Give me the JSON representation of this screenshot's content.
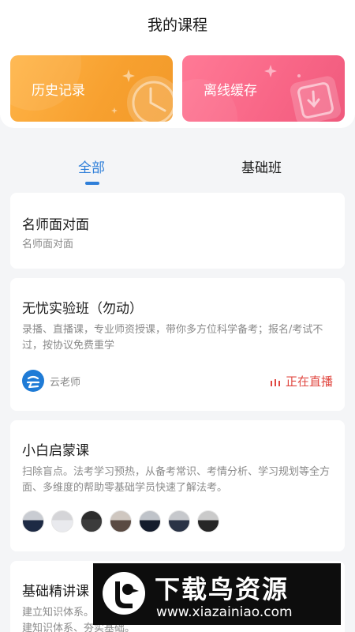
{
  "header": {
    "title": "我的课程"
  },
  "quick_actions": {
    "history": {
      "label": "历史记录",
      "color": "#f7a02f",
      "icon": "clock-icon"
    },
    "offline": {
      "label": "离线缓存",
      "color": "#f86586",
      "icon": "download-icon"
    }
  },
  "tabs": [
    {
      "label": "全部",
      "active": true
    },
    {
      "label": "基础班",
      "active": false
    }
  ],
  "courses": [
    {
      "title": "名师面对面",
      "desc": "名师面对面"
    },
    {
      "title": "无忧实验班（勿动）",
      "desc": "录播、直播课，专业师资授课，带你多方位科学备考；报名/考试不过，按协议免费重学",
      "teacher": "云老师",
      "teacher_icon": "cloud-logo-icon",
      "status": "正在直播",
      "status_color": "#e0463f"
    },
    {
      "title": "小白启蒙课",
      "desc": "扫除盲点。法考学习预热，从备考常识、考情分析、学习规划等全方面、多维度的帮助零基础学员快速了解法考。",
      "avatar_count": 7
    },
    {
      "title": "基础精讲课",
      "desc": "建立知识体系。\n建知识体系、夯实基础。"
    }
  ],
  "watermark": {
    "brand": "下载鸟资源",
    "url": "www.xiazainiao.com"
  },
  "colors": {
    "accent": "#2f7fd9",
    "live": "#e0463f"
  }
}
